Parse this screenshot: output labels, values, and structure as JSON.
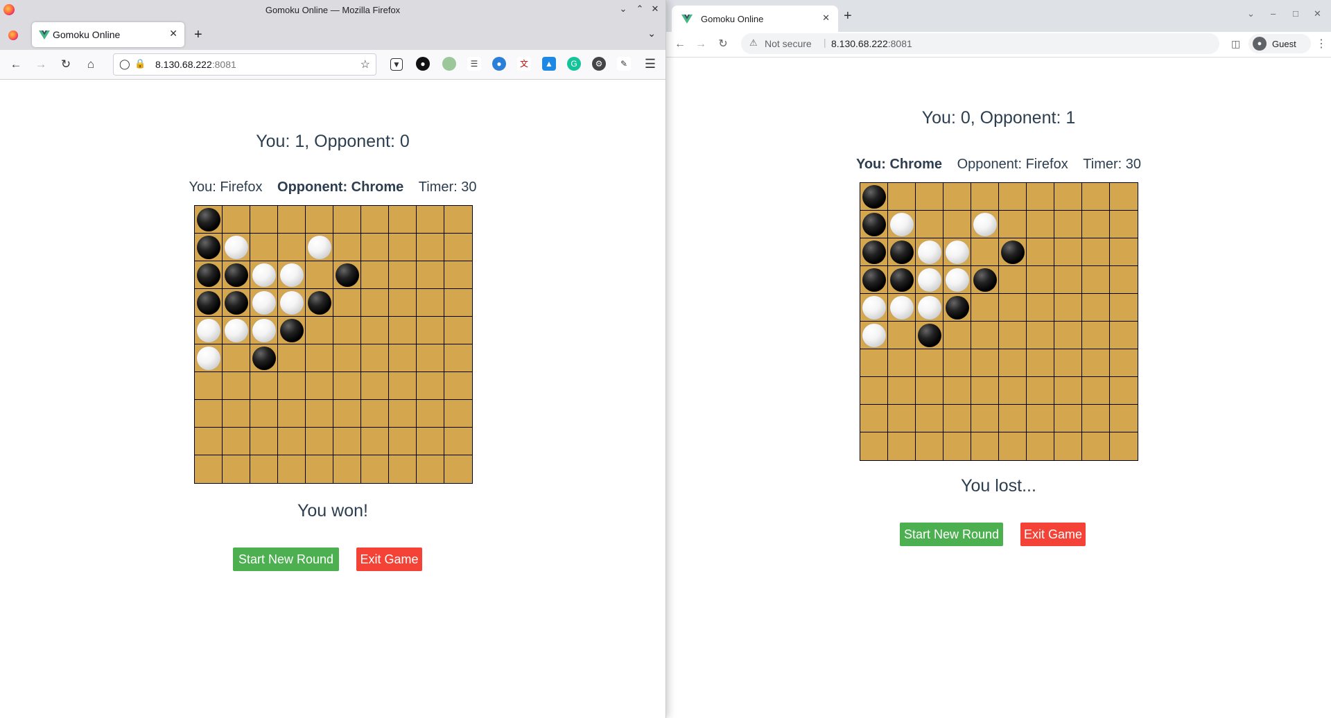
{
  "firefox": {
    "window_title": "Gomoku Online — Mozilla Firefox",
    "tab_title": "Gomoku Online",
    "url_host": "8.130.68.222",
    "url_port": ":8081",
    "game": {
      "score": "You: 1, Opponent: 0",
      "you_label": "You: Firefox",
      "opponent_label": "Opponent: Chrome",
      "timer_label": "Timer: 30",
      "bold_player": "opponent",
      "result": "You won!",
      "new_round_label": "Start New Round",
      "exit_label": "Exit Game",
      "board": [
        "B.........",
        "BW..W.....",
        "BBWW.B....",
        "BBWWB.....",
        "WWWB......",
        "W.B.......",
        "..........",
        "..........",
        "..........",
        ".........."
      ]
    }
  },
  "chrome": {
    "tab_title": "Gomoku Online",
    "not_secure": "Not secure",
    "url_host": "8.130.68.222",
    "url_port": ":8081",
    "profile": "Guest",
    "game": {
      "score": "You: 0, Opponent: 1",
      "you_label": "You: Chrome",
      "opponent_label": "Opponent: Firefox",
      "timer_label": "Timer: 30",
      "bold_player": "you",
      "result": "You lost...",
      "new_round_label": "Start New Round",
      "exit_label": "Exit Game",
      "board": [
        "B.........",
        "BW..W.....",
        "BBWW.B....",
        "BBWWB.....",
        "WWWB......",
        "W.B.......",
        "..........",
        "..........",
        "..........",
        ".........."
      ]
    }
  },
  "colors": {
    "board": "#d4a64e",
    "start_button": "#4caf50",
    "exit_button": "#f44336",
    "text": "#2c3e50"
  }
}
